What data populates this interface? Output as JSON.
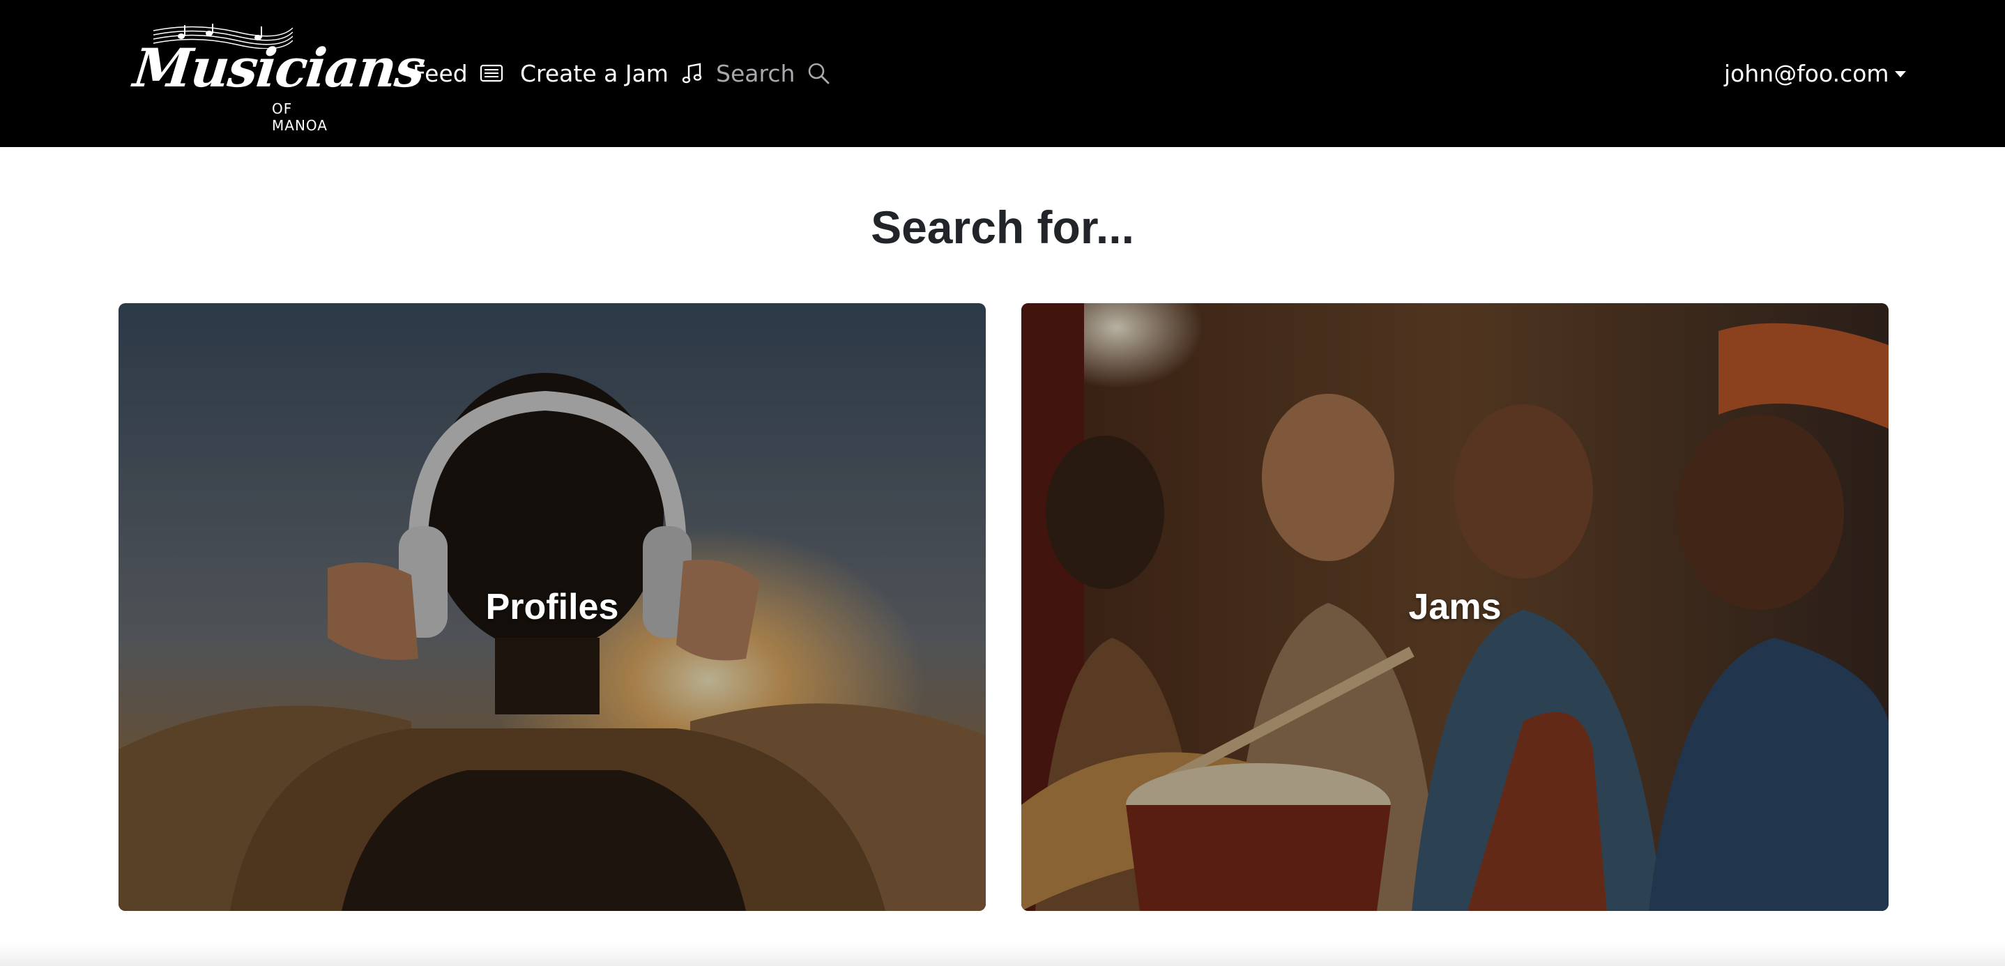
{
  "navbar": {
    "logo": {
      "title": "Musicians",
      "subtitle": "OF MANOA"
    },
    "links": [
      {
        "label": "Feed",
        "icon": "newspaper-icon"
      },
      {
        "label": "Create a Jam",
        "icon": "music-note-icon"
      },
      {
        "label": "Search",
        "icon": "search-icon"
      }
    ],
    "user": {
      "email": "john@foo.com",
      "icon": "caret-down-icon"
    }
  },
  "main": {
    "title": "Search for...",
    "cards": [
      {
        "label": "Profiles",
        "image": "person-with-headphones-sunset"
      },
      {
        "label": "Jams",
        "image": "group-playing-guitar-and-drum"
      }
    ]
  },
  "colors": {
    "navbar_bg": "#000000",
    "nav_text": "#ffffff",
    "nav_active": "#a9a9ad",
    "title_text": "#212529"
  }
}
